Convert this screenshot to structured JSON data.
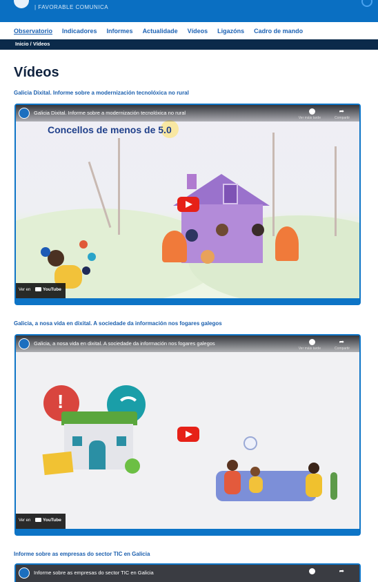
{
  "header": {
    "brand": "| FAVORABLE COMUNICA",
    "help_icon": "help-circle-icon"
  },
  "nav": {
    "items": [
      {
        "label": "Observatorio",
        "active": true
      },
      {
        "label": "Indicadores"
      },
      {
        "label": "Informes"
      },
      {
        "label": "Actualidade"
      },
      {
        "label": "Vídeos"
      },
      {
        "label": "Ligazóns"
      },
      {
        "label": "Cadro de mando"
      }
    ]
  },
  "breadcrumb": {
    "text": "Inicio / Vídeos"
  },
  "page": {
    "title": "Vídeos"
  },
  "videos": [
    {
      "heading": "Galicia Dixital. Informe sobre a modernización tecnolóxica no rural",
      "player_title": "Galicia Dixital. Informe sobre a modernización tecnolóxica no rural",
      "overlay_text": "Concellos de menos de 5.0",
      "watch_label": "Ver en",
      "youtube_label": "YouTube",
      "watch_later": "Ver máis tarde",
      "share": "Compartir"
    },
    {
      "heading": "Galicia, a nosa vida en dixital. A sociedade da información nos fogares galegos",
      "player_title": "Galicia, a nosa vida en dixital. A sociedade da información nos fogares galegos",
      "watch_label": "Ver en",
      "youtube_label": "YouTube",
      "watch_later": "Ver máis tarde",
      "share": "Compartir"
    },
    {
      "heading": "Informe sobre as empresas do sector TIC en Galicia",
      "player_title": "Informe sobre as empresas do sector TIC en Galicia"
    }
  ],
  "colors": {
    "header_blue": "#0a6fc2",
    "nav_link": "#1e63b4",
    "breadcrumb_bg": "#0b2a4a",
    "youtube_red": "#e62117"
  }
}
